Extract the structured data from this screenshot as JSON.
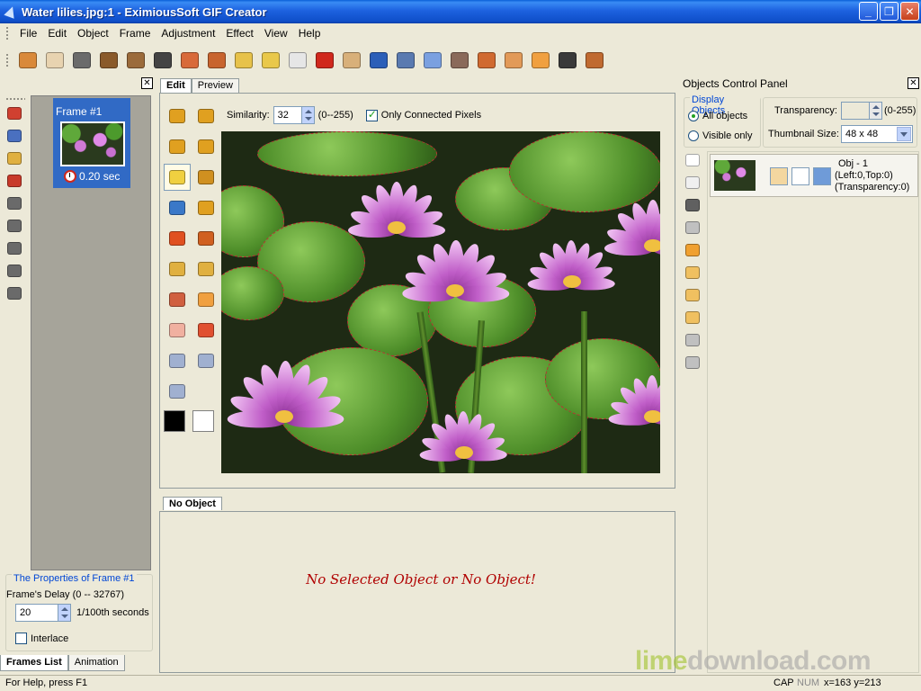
{
  "window": {
    "title": "Water lilies.jpg:1 - EximiousSoft GIF Creator",
    "controls": [
      "_",
      "❐",
      "✕"
    ]
  },
  "menu": [
    "File",
    "Edit",
    "Object",
    "Frame",
    "Adjustment",
    "Effect",
    "View",
    "Help"
  ],
  "toolbar": {
    "icon_colors": [
      "#d9893a",
      "#e8d3b0",
      "#6b6b6b",
      "#8a5a2a",
      "#9b6b3b",
      "#444",
      "#d86a3a",
      "#c8642e",
      "#e7c24a",
      "#e9c84a",
      "#e6e6e6",
      "#d0281c",
      "#d8b07a",
      "#2c5fb8",
      "#5a7ab0",
      "#7aa0e0",
      "#8a6a5a",
      "#d06a30",
      "#e29a58",
      "#f0a040",
      "#3a3a3a",
      "#c06a30"
    ]
  },
  "left_panel": {
    "frame_label": "Frame #1",
    "frame_time": "0.20 sec",
    "properties_title": "The Properties of Frame #1",
    "delay_label": "Frame's Delay (0 -- 32767)",
    "delay_value": "20",
    "delay_unit": "1/100th seconds",
    "interlace_label": "Interlace",
    "tabs": [
      "Frames List",
      "Animation"
    ]
  },
  "editor": {
    "tabs": [
      "Edit",
      "Preview"
    ],
    "similarity_label": "Similarity:",
    "similarity_value": "32",
    "similarity_range": "(0--255)",
    "connected_label": "Only Connected Pixels",
    "foreground_color": "#000000",
    "background_color": "#ffffff"
  },
  "object_panel": {
    "tab": "No Object",
    "message": "No Selected Object or No Object!"
  },
  "right_panel": {
    "title": "Objects Control Panel",
    "display_title": "Display Objects",
    "opt_all": "All objects",
    "opt_visible": "Visible only",
    "transparency_label": "Transparency:",
    "transparency_range": "(0-255)",
    "thumb_label": "Thumbnail Size:",
    "thumb_value": "48 x 48",
    "object": {
      "name": "Obj - 1",
      "position": "(Left:0,Top:0)",
      "transparency": "(Transparency:0)"
    }
  },
  "watermark": {
    "lime": "lime",
    "rest": "download.com"
  },
  "status": {
    "help": "For Help, press F1",
    "cap": "CAP",
    "num": "NUM",
    "coords": "x=163 y=213"
  }
}
